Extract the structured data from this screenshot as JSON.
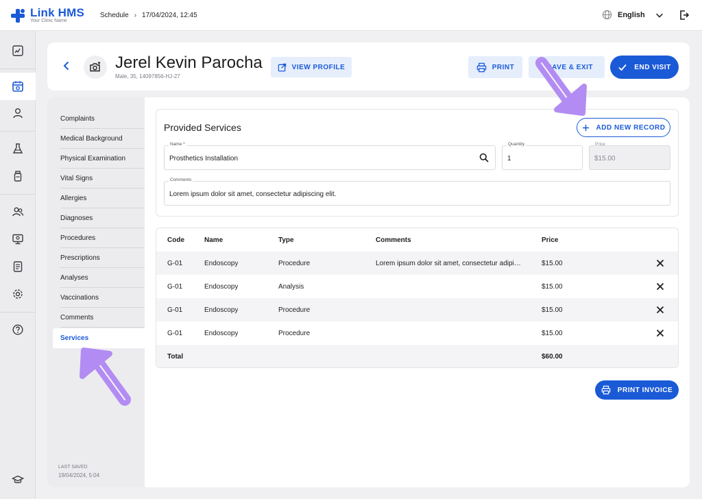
{
  "app": {
    "name": "Link HMS",
    "clinic": "Your Clinic Name"
  },
  "breadcrumb": {
    "section": "Schedule",
    "separator": "›",
    "datetime": "17/04/2024, 12:45"
  },
  "language": {
    "selected": "English"
  },
  "patient": {
    "name": "Jerel Kevin Parocha",
    "meta": "Male, 35, 14097856-HJ-27"
  },
  "actions": {
    "view_profile": "VIEW PROFILE",
    "print": "PRINT",
    "save_exit": "SAVE & EXIT",
    "end_visit": "END VISIT",
    "add_new_record": "ADD NEW RECORD",
    "print_invoice": "PRINT INVOICE"
  },
  "side_nav": {
    "items": [
      {
        "label": "Complaints"
      },
      {
        "label": "Medical Background"
      },
      {
        "label": "Physical Examination"
      },
      {
        "label": "Vital Signs"
      },
      {
        "label": "Allergies"
      },
      {
        "label": "Diagnoses"
      },
      {
        "label": "Procedures"
      },
      {
        "label": "Prescriptions"
      },
      {
        "label": "Analyses"
      },
      {
        "label": "Vaccinations"
      },
      {
        "label": "Comments"
      },
      {
        "label": "Services"
      }
    ],
    "active": "Services",
    "last_saved_label": "LAST SAVED",
    "last_saved_time": "19/04/2024, 5:04"
  },
  "form": {
    "title": "Provided Services",
    "name_label": "Name *",
    "name_value": "Prosthetics Installation",
    "quantity_label": "Quantity",
    "quantity_value": "1",
    "price_label": "Price",
    "price_value": "$15.00",
    "comments_label": "Comments",
    "comments_value": "Lorem ipsum dolor sit amet, consectetur adipiscing elit."
  },
  "table": {
    "headers": {
      "code": "Code",
      "name": "Name",
      "type": "Type",
      "comments": "Comments",
      "price": "Price"
    },
    "rows": [
      {
        "code": "G-01",
        "name": "Endoscopy",
        "type": "Procedure",
        "comments": "Lorem ipsum dolor sit amet, consectetur adipiscing elit.",
        "price": "$15.00"
      },
      {
        "code": "G-01",
        "name": "Endoscopy",
        "type": "Analysis",
        "comments": "",
        "price": "$15.00"
      },
      {
        "code": "G-01",
        "name": "Endoscopy",
        "type": "Procedure",
        "comments": "",
        "price": "$15.00"
      },
      {
        "code": "G-01",
        "name": "Endoscopy",
        "type": "Procedure",
        "comments": "",
        "price": "$15.00"
      }
    ],
    "total_label": "Total",
    "total_value": "$60.00"
  },
  "icons": {
    "rail": [
      "dashboard-icon",
      "calendar-icon",
      "user-icon",
      "flask-icon",
      "medicine-bottle-icon",
      "patients-icon",
      "monitor-icon",
      "report-icon",
      "settings-icon",
      "help-icon",
      "graduation-cap-icon"
    ]
  },
  "colors": {
    "primary": "#1a5ad7",
    "primary_soft": "#e6eefc",
    "annotation": "#b28cf2"
  }
}
